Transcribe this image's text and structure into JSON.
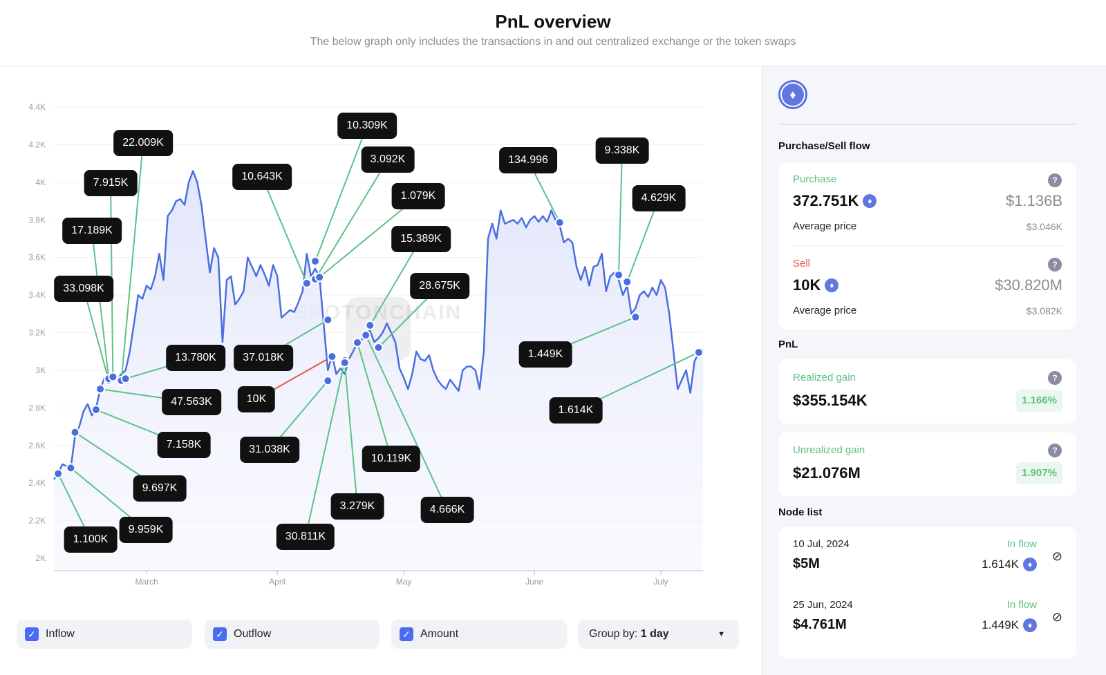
{
  "header": {
    "title": "PnL overview",
    "subtitle": "The below graph only includes the transactions in and out centralized exchange or the token swaps"
  },
  "watermark": "SPOTONCHAIN",
  "colors": {
    "line": "#4a6ee0",
    "inflow": "#5cc286",
    "outflow": "#e0584f",
    "label_bg": "#111111",
    "checkbox": "#4a6cf0"
  },
  "chart_data": {
    "type": "line",
    "ylim": [
      2000,
      4400
    ],
    "yticks": [
      {
        "v": 2000,
        "label": "2K"
      },
      {
        "v": 2200,
        "label": "2.2K"
      },
      {
        "v": 2400,
        "label": "2.4K"
      },
      {
        "v": 2600,
        "label": "2.6K"
      },
      {
        "v": 2800,
        "label": "2.8K"
      },
      {
        "v": 3000,
        "label": "3K"
      },
      {
        "v": 3200,
        "label": "3.2K"
      },
      {
        "v": 3400,
        "label": "3.4K"
      },
      {
        "v": 3600,
        "label": "3.6K"
      },
      {
        "v": 3800,
        "label": "3.8K"
      },
      {
        "v": 4000,
        "label": "4K"
      },
      {
        "v": 4200,
        "label": "4.2K"
      },
      {
        "v": 4400,
        "label": "4.4K"
      }
    ],
    "xticks": [
      {
        "date": "2024-03-01",
        "label": "March"
      },
      {
        "date": "2024-04-01",
        "label": "April"
      },
      {
        "date": "2024-05-01",
        "label": "May"
      },
      {
        "date": "2024-06-01",
        "label": "June"
      },
      {
        "date": "2024-07-01",
        "label": "July"
      }
    ],
    "xlim": [
      "2024-02-08",
      "2024-07-11"
    ],
    "grid": true,
    "points": [
      [
        "2024-02-08",
        2420
      ],
      [
        "2024-02-09",
        2450
      ],
      [
        "2024-02-10",
        2500
      ],
      [
        "2024-02-11",
        2490
      ],
      [
        "2024-02-12",
        2480
      ],
      [
        "2024-02-13",
        2650
      ],
      [
        "2024-02-14",
        2700
      ],
      [
        "2024-02-15",
        2780
      ],
      [
        "2024-02-16",
        2820
      ],
      [
        "2024-02-17",
        2760
      ],
      [
        "2024-02-18",
        2800
      ],
      [
        "2024-02-19",
        2900
      ],
      [
        "2024-02-20",
        2960
      ],
      [
        "2024-02-21",
        2940
      ],
      [
        "2024-02-22",
        2970
      ],
      [
        "2024-02-23",
        2950
      ],
      [
        "2024-02-24",
        2980
      ],
      [
        "2024-02-25",
        3000
      ],
      [
        "2024-02-26",
        3100
      ],
      [
        "2024-02-27",
        3250
      ],
      [
        "2024-02-28",
        3400
      ],
      [
        "2024-02-29",
        3380
      ],
      [
        "2024-03-01",
        3450
      ],
      [
        "2024-03-02",
        3430
      ],
      [
        "2024-03-03",
        3500
      ],
      [
        "2024-03-04",
        3620
      ],
      [
        "2024-03-05",
        3480
      ],
      [
        "2024-03-06",
        3820
      ],
      [
        "2024-03-07",
        3850
      ],
      [
        "2024-03-08",
        3900
      ],
      [
        "2024-03-09",
        3910
      ],
      [
        "2024-03-10",
        3880
      ],
      [
        "2024-03-11",
        4000
      ],
      [
        "2024-03-12",
        4060
      ],
      [
        "2024-03-13",
        4000
      ],
      [
        "2024-03-14",
        3880
      ],
      [
        "2024-03-15",
        3700
      ],
      [
        "2024-03-16",
        3520
      ],
      [
        "2024-03-17",
        3650
      ],
      [
        "2024-03-18",
        3600
      ],
      [
        "2024-03-19",
        3150
      ],
      [
        "2024-03-20",
        3480
      ],
      [
        "2024-03-21",
        3500
      ],
      [
        "2024-03-22",
        3350
      ],
      [
        "2024-03-23",
        3380
      ],
      [
        "2024-03-24",
        3420
      ],
      [
        "2024-03-25",
        3600
      ],
      [
        "2024-03-26",
        3550
      ],
      [
        "2024-03-27",
        3500
      ],
      [
        "2024-03-28",
        3560
      ],
      [
        "2024-03-29",
        3510
      ],
      [
        "2024-03-30",
        3450
      ],
      [
        "2024-03-31",
        3560
      ],
      [
        "2024-04-01",
        3500
      ],
      [
        "2024-04-02",
        3280
      ],
      [
        "2024-04-03",
        3300
      ],
      [
        "2024-04-04",
        3320
      ],
      [
        "2024-04-05",
        3310
      ],
      [
        "2024-04-06",
        3360
      ],
      [
        "2024-04-07",
        3420
      ],
      [
        "2024-04-08",
        3620
      ],
      [
        "2024-04-09",
        3500
      ],
      [
        "2024-04-10",
        3540
      ],
      [
        "2024-04-11",
        3500
      ],
      [
        "2024-04-12",
        3250
      ],
      [
        "2024-04-13",
        3000
      ],
      [
        "2024-04-14",
        3080
      ],
      [
        "2024-04-15",
        2980
      ],
      [
        "2024-04-16",
        3010
      ],
      [
        "2024-04-17",
        2980
      ],
      [
        "2024-04-18",
        3060
      ],
      [
        "2024-04-19",
        3100
      ],
      [
        "2024-04-20",
        3150
      ],
      [
        "2024-04-21",
        3160
      ],
      [
        "2024-04-22",
        3200
      ],
      [
        "2024-04-23",
        3210
      ],
      [
        "2024-04-24",
        3150
      ],
      [
        "2024-04-25",
        3170
      ],
      [
        "2024-04-26",
        3200
      ],
      [
        "2024-04-27",
        3250
      ],
      [
        "2024-04-28",
        3200
      ],
      [
        "2024-04-29",
        3150
      ],
      [
        "2024-04-30",
        3010
      ],
      [
        "2024-05-01",
        2960
      ],
      [
        "2024-05-02",
        2900
      ],
      [
        "2024-05-03",
        2980
      ],
      [
        "2024-05-04",
        3100
      ],
      [
        "2024-05-05",
        3060
      ],
      [
        "2024-05-06",
        3050
      ],
      [
        "2024-05-07",
        3080
      ],
      [
        "2024-05-08",
        3000
      ],
      [
        "2024-05-09",
        2950
      ],
      [
        "2024-05-10",
        2920
      ],
      [
        "2024-05-11",
        2900
      ],
      [
        "2024-05-12",
        2950
      ],
      [
        "2024-05-13",
        2920
      ],
      [
        "2024-05-14",
        2890
      ],
      [
        "2024-05-15",
        3000
      ],
      [
        "2024-05-16",
        3020
      ],
      [
        "2024-05-17",
        3020
      ],
      [
        "2024-05-18",
        3000
      ],
      [
        "2024-05-19",
        2900
      ],
      [
        "2024-05-20",
        3100
      ],
      [
        "2024-05-21",
        3700
      ],
      [
        "2024-05-22",
        3780
      ],
      [
        "2024-05-23",
        3700
      ],
      [
        "2024-05-24",
        3850
      ],
      [
        "2024-05-25",
        3780
      ],
      [
        "2024-05-26",
        3790
      ],
      [
        "2024-05-27",
        3800
      ],
      [
        "2024-05-28",
        3780
      ],
      [
        "2024-05-29",
        3810
      ],
      [
        "2024-05-30",
        3760
      ],
      [
        "2024-05-31",
        3800
      ],
      [
        "2024-06-01",
        3820
      ],
      [
        "2024-06-02",
        3790
      ],
      [
        "2024-06-03",
        3820
      ],
      [
        "2024-06-04",
        3790
      ],
      [
        "2024-06-05",
        3850
      ],
      [
        "2024-06-06",
        3800
      ],
      [
        "2024-06-07",
        3770
      ],
      [
        "2024-06-08",
        3680
      ],
      [
        "2024-06-09",
        3700
      ],
      [
        "2024-06-10",
        3680
      ],
      [
        "2024-06-11",
        3550
      ],
      [
        "2024-06-12",
        3480
      ],
      [
        "2024-06-13",
        3550
      ],
      [
        "2024-06-14",
        3450
      ],
      [
        "2024-06-15",
        3550
      ],
      [
        "2024-06-16",
        3560
      ],
      [
        "2024-06-17",
        3620
      ],
      [
        "2024-06-18",
        3420
      ],
      [
        "2024-06-19",
        3500
      ],
      [
        "2024-06-20",
        3520
      ],
      [
        "2024-06-21",
        3480
      ],
      [
        "2024-06-22",
        3400
      ],
      [
        "2024-06-23",
        3450
      ],
      [
        "2024-06-24",
        3300
      ],
      [
        "2024-06-25",
        3330
      ],
      [
        "2024-06-26",
        3400
      ],
      [
        "2024-06-27",
        3420
      ],
      [
        "2024-06-28",
        3390
      ],
      [
        "2024-06-29",
        3440
      ],
      [
        "2024-06-30",
        3400
      ],
      [
        "2024-07-01",
        3480
      ],
      [
        "2024-07-02",
        3440
      ],
      [
        "2024-07-03",
        3300
      ],
      [
        "2024-07-04",
        3100
      ],
      [
        "2024-07-05",
        2900
      ],
      [
        "2024-07-06",
        2950
      ],
      [
        "2024-07-07",
        3000
      ],
      [
        "2024-07-08",
        2880
      ],
      [
        "2024-07-09",
        3050
      ],
      [
        "2024-07-10",
        3090
      ],
      [
        "2024-07-11",
        3110
      ]
    ],
    "nodes": [
      {
        "date": "2024-02-09",
        "price": 2450,
        "amount": "1.100K",
        "type": "inflow"
      },
      {
        "date": "2024-02-12",
        "price": 2480,
        "amount": "9.959K",
        "type": "inflow"
      },
      {
        "date": "2024-02-13",
        "price": 2670,
        "amount": "9.697K",
        "type": "inflow"
      },
      {
        "date": "2024-02-18",
        "price": 2790,
        "amount": "7.158K",
        "type": "inflow"
      },
      {
        "date": "2024-02-19",
        "price": 2900,
        "amount": "47.563K",
        "type": "inflow"
      },
      {
        "date": "2024-02-21",
        "price": 2945,
        "amount": "33.098K",
        "type": "inflow"
      },
      {
        "date": "2024-02-21",
        "price": 2955,
        "amount": "17.189K",
        "type": "inflow"
      },
      {
        "date": "2024-02-22",
        "price": 2965,
        "amount": "7.915K",
        "type": "inflow"
      },
      {
        "date": "2024-02-24",
        "price": 2945,
        "amount": "22.009K",
        "type": "inflow"
      },
      {
        "date": "2024-02-25",
        "price": 2955,
        "amount": "13.780K",
        "type": "inflow"
      },
      {
        "date": "2024-04-08",
        "price": 3463,
        "amount": "10.643K",
        "type": "inflow"
      },
      {
        "date": "2024-04-10",
        "price": 3580,
        "amount": "10.309K",
        "type": "inflow"
      },
      {
        "date": "2024-04-10",
        "price": 3485,
        "amount": "3.092K",
        "type": "inflow"
      },
      {
        "date": "2024-04-11",
        "price": 3495,
        "amount": "1.079K",
        "type": "inflow"
      },
      {
        "date": "2024-04-13",
        "price": 3268,
        "amount": "37.018K",
        "type": "inflow"
      },
      {
        "date": "2024-04-14",
        "price": 3073,
        "amount": "10K",
        "type": "outflow"
      },
      {
        "date": "2024-04-13",
        "price": 2944,
        "amount": "31.038K",
        "type": "inflow"
      },
      {
        "date": "2024-04-17",
        "price": 3051,
        "amount": "30.811K",
        "type": "inflow"
      },
      {
        "date": "2024-04-17",
        "price": 3040,
        "amount": "3.279K",
        "type": "inflow"
      },
      {
        "date": "2024-04-20",
        "price": 3147,
        "amount": "10.119K",
        "type": "inflow"
      },
      {
        "date": "2024-04-22",
        "price": 3187,
        "amount": "4.666K",
        "type": "inflow"
      },
      {
        "date": "2024-04-23",
        "price": 3239,
        "amount": "15.389K",
        "type": "inflow"
      },
      {
        "date": "2024-04-25",
        "price": 3121,
        "amount": "28.675K",
        "type": "inflow"
      },
      {
        "date": "2024-06-07",
        "price": 3786,
        "amount": "134.996",
        "type": "inflow"
      },
      {
        "date": "2024-06-21",
        "price": 3507,
        "amount": "9.338K",
        "type": "inflow"
      },
      {
        "date": "2024-06-23",
        "price": 3470,
        "amount": "4.629K",
        "type": "inflow"
      },
      {
        "date": "2024-06-25",
        "price": 3283,
        "amount": "1.449K",
        "type": "inflow"
      },
      {
        "date": "2024-07-10",
        "price": 3095,
        "amount": "1.614K",
        "type": "inflow"
      }
    ]
  },
  "controls": {
    "inflow": "Inflow",
    "outflow": "Outflow",
    "amount": "Amount",
    "group_by_label": "Group by:",
    "group_by_value": "1 day",
    "check": "✓",
    "caret": "▼"
  },
  "panel": {
    "token_icon": "ethereum-icon",
    "purchase_sell_title": "Purchase/Sell flow",
    "purchase": {
      "label": "Purchase",
      "amount": "372.751K",
      "usd": "$1.136B",
      "avg_label": "Average price",
      "avg": "$3.046K"
    },
    "sell": {
      "label": "Sell",
      "amount": "10K",
      "usd": "$30.820M",
      "avg_label": "Average price",
      "avg": "$3.082K"
    },
    "pnl_title": "PnL",
    "realized": {
      "label": "Realized gain",
      "value": "$355.154K",
      "pct": "1.166%"
    },
    "unrealized": {
      "label": "Unrealized gain",
      "value": "$21.076M",
      "pct": "1.907%"
    },
    "node_list_title": "Node list",
    "node_list": [
      {
        "date": "10 Jul, 2024",
        "usd": "$5M",
        "type": "In flow",
        "amount": "1.614K"
      },
      {
        "date": "25 Jun, 2024",
        "usd": "$4.761M",
        "type": "In flow",
        "amount": "1.449K"
      }
    ],
    "help": "?",
    "eth": "♦",
    "eye_off": "⊘"
  }
}
